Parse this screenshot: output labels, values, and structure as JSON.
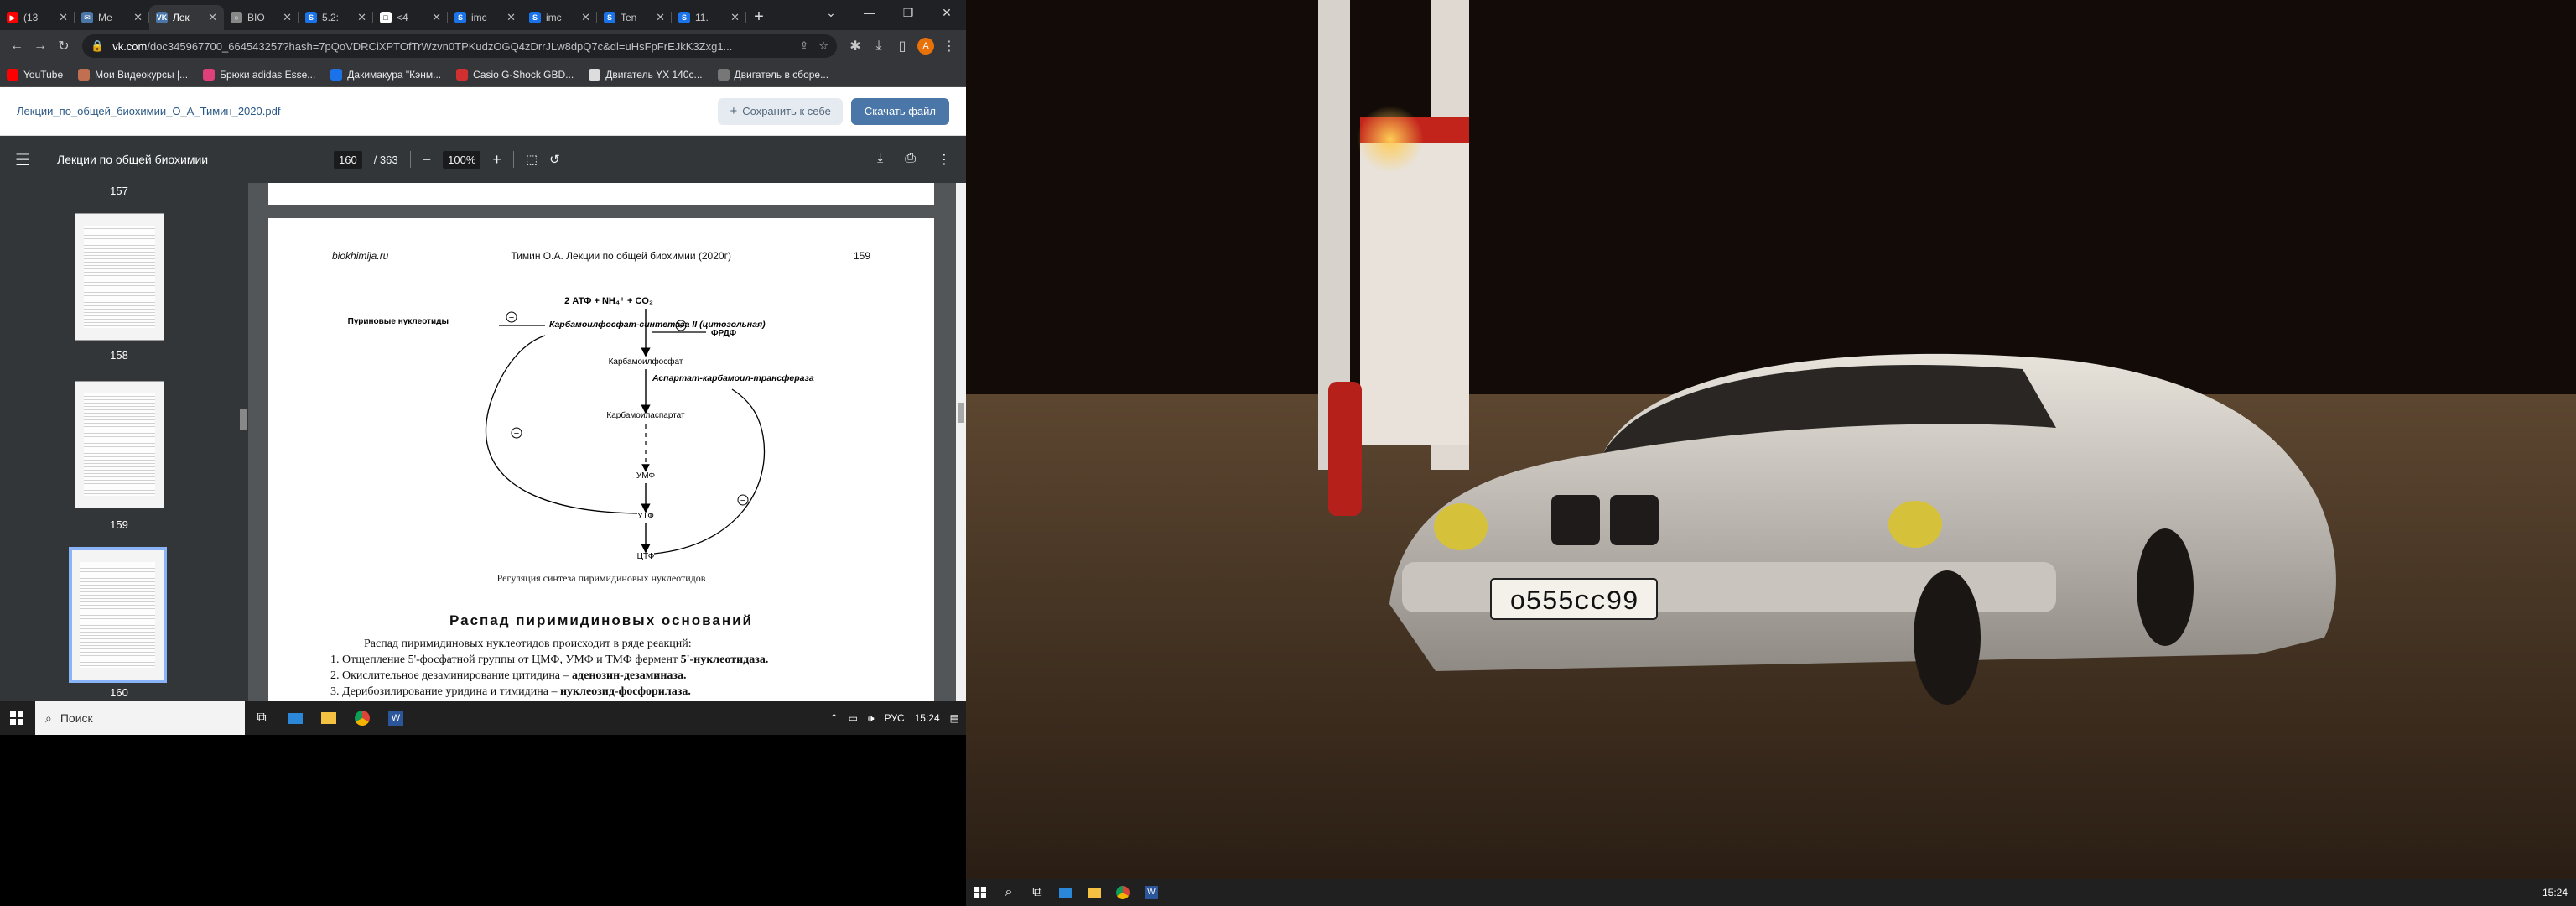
{
  "browser": {
    "tabs": [
      {
        "label": "(13",
        "color": "#ff0000",
        "glyph": "▶",
        "active": false
      },
      {
        "label": "Ме",
        "color": "#4a76a8",
        "glyph": "✉",
        "active": false
      },
      {
        "label": "Лек",
        "color": "#4a76a8",
        "glyph": "VK",
        "active": true
      },
      {
        "label": "BIO",
        "color": "#888888",
        "glyph": "○",
        "active": false
      },
      {
        "label": "5.2:",
        "color": "#1a73e8",
        "glyph": "S",
        "active": false
      },
      {
        "label": "<4",
        "color": "#ffffff",
        "glyph": "□",
        "active": false
      },
      {
        "label": "imc",
        "color": "#1a73e8",
        "glyph": "S",
        "active": false
      },
      {
        "label": "imc",
        "color": "#1a73e8",
        "glyph": "S",
        "active": false
      },
      {
        "label": "Ten",
        "color": "#1a73e8",
        "glyph": "S",
        "active": false
      },
      {
        "label": "11.",
        "color": "#1a73e8",
        "glyph": "S",
        "active": false
      }
    ],
    "new_tab": "+",
    "url_host": "vk.com",
    "url_rest": "/doc345967700_664543257?hash=7pQoVDRCiXPTOfTrWzvn0TPKudzOGQ4zDrrJLw8dpQ7c&dl=uHsFpFrEJkK3Zxg1...",
    "profile_initial": "A",
    "bookmarks": [
      {
        "label": "YouTube",
        "color": "#ff0000"
      },
      {
        "label": "Мои Видеокурсы |...",
        "color": "#c07050"
      },
      {
        "label": "Брюки adidas Esse...",
        "color": "#e0407a"
      },
      {
        "label": "Дакимакура \"Кэнм...",
        "color": "#1a73e8"
      },
      {
        "label": "Casio G-Shock GBD...",
        "color": "#d03030"
      },
      {
        "label": "Двигатель YX 140с...",
        "color": "#dddddd"
      },
      {
        "label": "Двигатель в сборе...",
        "color": "#777777"
      }
    ]
  },
  "vk": {
    "filename": "Лекции_по_общей_биохимии_О_А_Тимин_2020.pdf",
    "save_label": "Сохранить к себе",
    "download_label": "Скачать файл"
  },
  "pdf": {
    "title": "Лекции по общей биохимии",
    "page_current": "160",
    "page_total": "/ 363",
    "zoom": "100%",
    "thumbnails": [
      {
        "num": "157"
      },
      {
        "num": "158"
      },
      {
        "num": "159"
      },
      {
        "num": "160"
      }
    ],
    "page": {
      "header_site": "biokhimija.ru",
      "header_title": "Тимин О.А. Лекции по общей биохимии (2020г)",
      "header_num": "159",
      "diagram": {
        "top": "2 АТФ + NH₄⁺ + CO₂",
        "purine": "Пуриновые нуклеотиды",
        "enzyme1": "Карбамоилфосфат-синтетаза II (цитозольная)",
        "prpp": "ФРДФ",
        "carbamoylphosphate": "Карбамоилфосфат",
        "enzyme2": "Аспартат-карбамоил-трансфераза",
        "carbamoylaspartate": "Карбамоиласпартат",
        "ump": "УМФ",
        "utp": "УТФ",
        "ctp": "ЦТФ",
        "minus": "⊖",
        "plus": "⊕"
      },
      "caption": "Регуляция синтеза пиримидиновых нуклеотидов",
      "section_title": "Распад пиримидиновых оснований",
      "intro": "Распад пиримидиновых нуклеотидов происходит в ряде реакций:",
      "steps": [
        {
          "text": "1. Отщепление 5'-фосфатной группы от ЦМФ, УМФ и ТМФ фермент ",
          "bold": "5'-нуклеотидаза."
        },
        {
          "text": "2. Окислительное дезаминирование цитидина – ",
          "bold": "аденозин-дезаминаза."
        },
        {
          "text": "3. Дерибозилирование уридина и тимидина – ",
          "bold": "нуклеозид-фосфорилаза."
        }
      ]
    }
  },
  "taskbar": {
    "search_placeholder": "Поиск",
    "lang": "РУС",
    "time": "15:24"
  },
  "wallpaper": {
    "plate": "о555сс99"
  }
}
